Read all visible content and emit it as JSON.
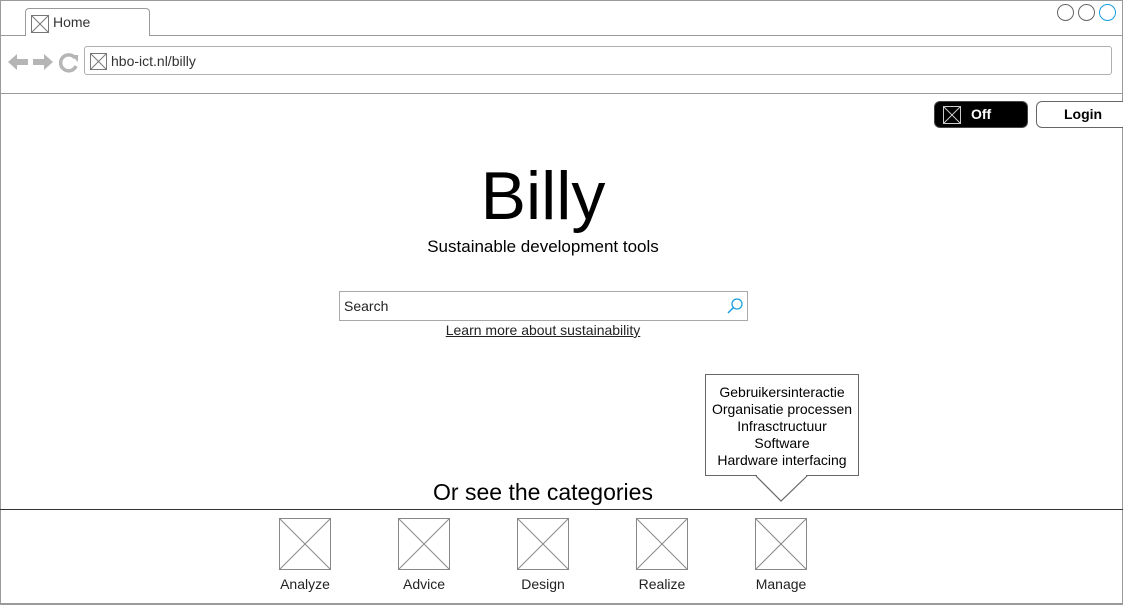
{
  "browser": {
    "tab_label": "Home",
    "url": "hbo-ict.nl/billy"
  },
  "header": {
    "toggle_label": "Off",
    "login_label": "Login"
  },
  "hero": {
    "title": "Billy",
    "subtitle": "Sustainable development tools",
    "search_placeholder": "Search",
    "learn_more_link": "Learn more about sustainability"
  },
  "popover": {
    "items": [
      "Gebruikersinteractie",
      "Organisatie processen",
      "Infrasctructuur",
      "Software",
      "Hardware interfacing"
    ]
  },
  "categories": {
    "title": "Or see the categories",
    "items": [
      {
        "label": "Analyze",
        "icon": "image-placeholder-icon"
      },
      {
        "label": "Advice",
        "icon": "image-placeholder-icon"
      },
      {
        "label": "Design",
        "icon": "image-placeholder-icon"
      },
      {
        "label": "Realize",
        "icon": "image-placeholder-icon"
      },
      {
        "label": "Manage",
        "icon": "image-placeholder-icon"
      }
    ]
  },
  "colors": {
    "accent": "#1a9fe0",
    "toggle_bg": "#000000"
  }
}
